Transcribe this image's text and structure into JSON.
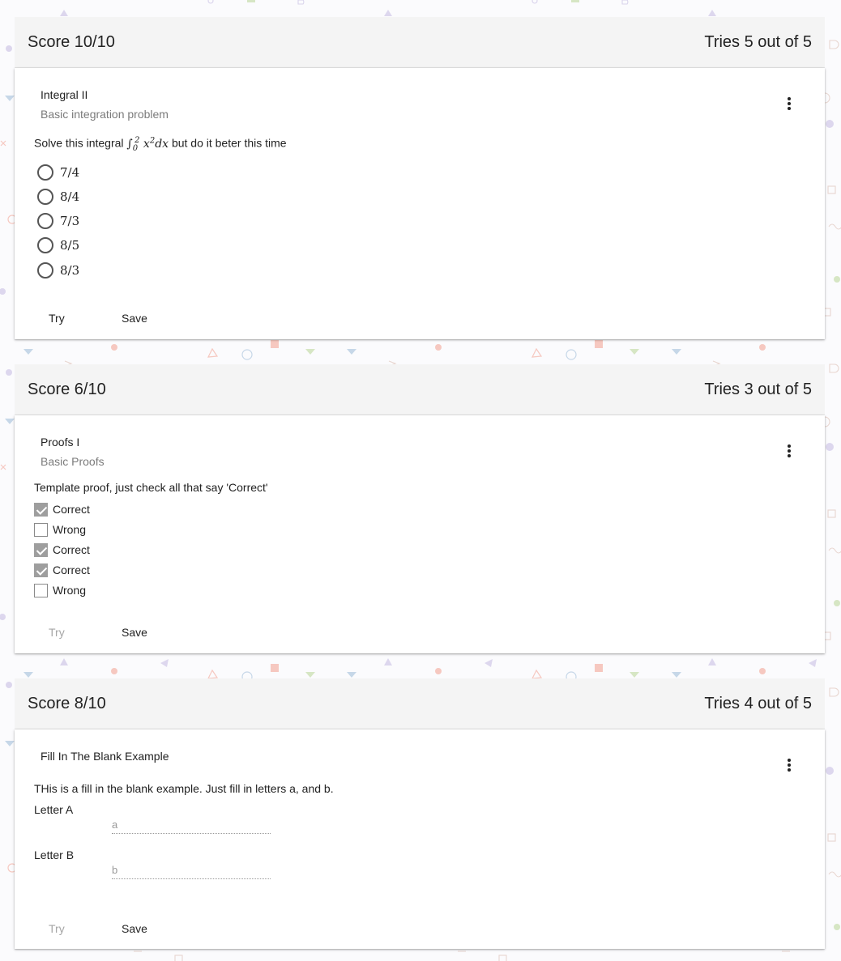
{
  "cards": [
    {
      "score": "Score 10/10",
      "tries": "Tries 5 out of 5",
      "title": "Integral II",
      "subtitle": "Basic integration problem",
      "question_pre": "Solve this integral",
      "question_math": "∫",
      "question_math_sup": "2",
      "question_math_sub": "0",
      "question_math_body": "x",
      "question_math_body_sup": "2",
      "question_math_tail": "dx",
      "question_post": "but do it beter this time",
      "options": [
        "7/4",
        "8/4",
        "7/3",
        "8/5",
        "8/3"
      ],
      "try_label": "Try",
      "save_label": "Save"
    },
    {
      "score": "Score 6/10",
      "tries": "Tries 3 out of 5",
      "title": "Proofs I",
      "subtitle": "Basic Proofs",
      "question": "Template proof, just check all that say 'Correct'",
      "options": [
        {
          "label": "Correct",
          "checked": true
        },
        {
          "label": "Wrong",
          "checked": false
        },
        {
          "label": "Correct",
          "checked": true
        },
        {
          "label": "Correct",
          "checked": true
        },
        {
          "label": "Wrong",
          "checked": false
        }
      ],
      "try_label": "Try",
      "save_label": "Save"
    },
    {
      "score": "Score 8/10",
      "tries": "Tries 4 out of 5",
      "title": "Fill In The Blank Example",
      "question": "THis is a fill in the blank example. Just fill in letters a, and b.",
      "fields": [
        {
          "label": "Letter A",
          "placeholder": "a"
        },
        {
          "label": "Letter B",
          "placeholder": "b"
        }
      ],
      "try_label": "Try",
      "save_label": "Save"
    }
  ],
  "colors": {
    "score_bar": "#f4f4f4",
    "disabled_text": "#a6a6a6",
    "checkbox_checked": "#9e9e9e"
  },
  "icons": {
    "menu": "more-vert-icon",
    "radio": "radio-unchecked-icon",
    "checkbox": "checkbox-icon"
  }
}
